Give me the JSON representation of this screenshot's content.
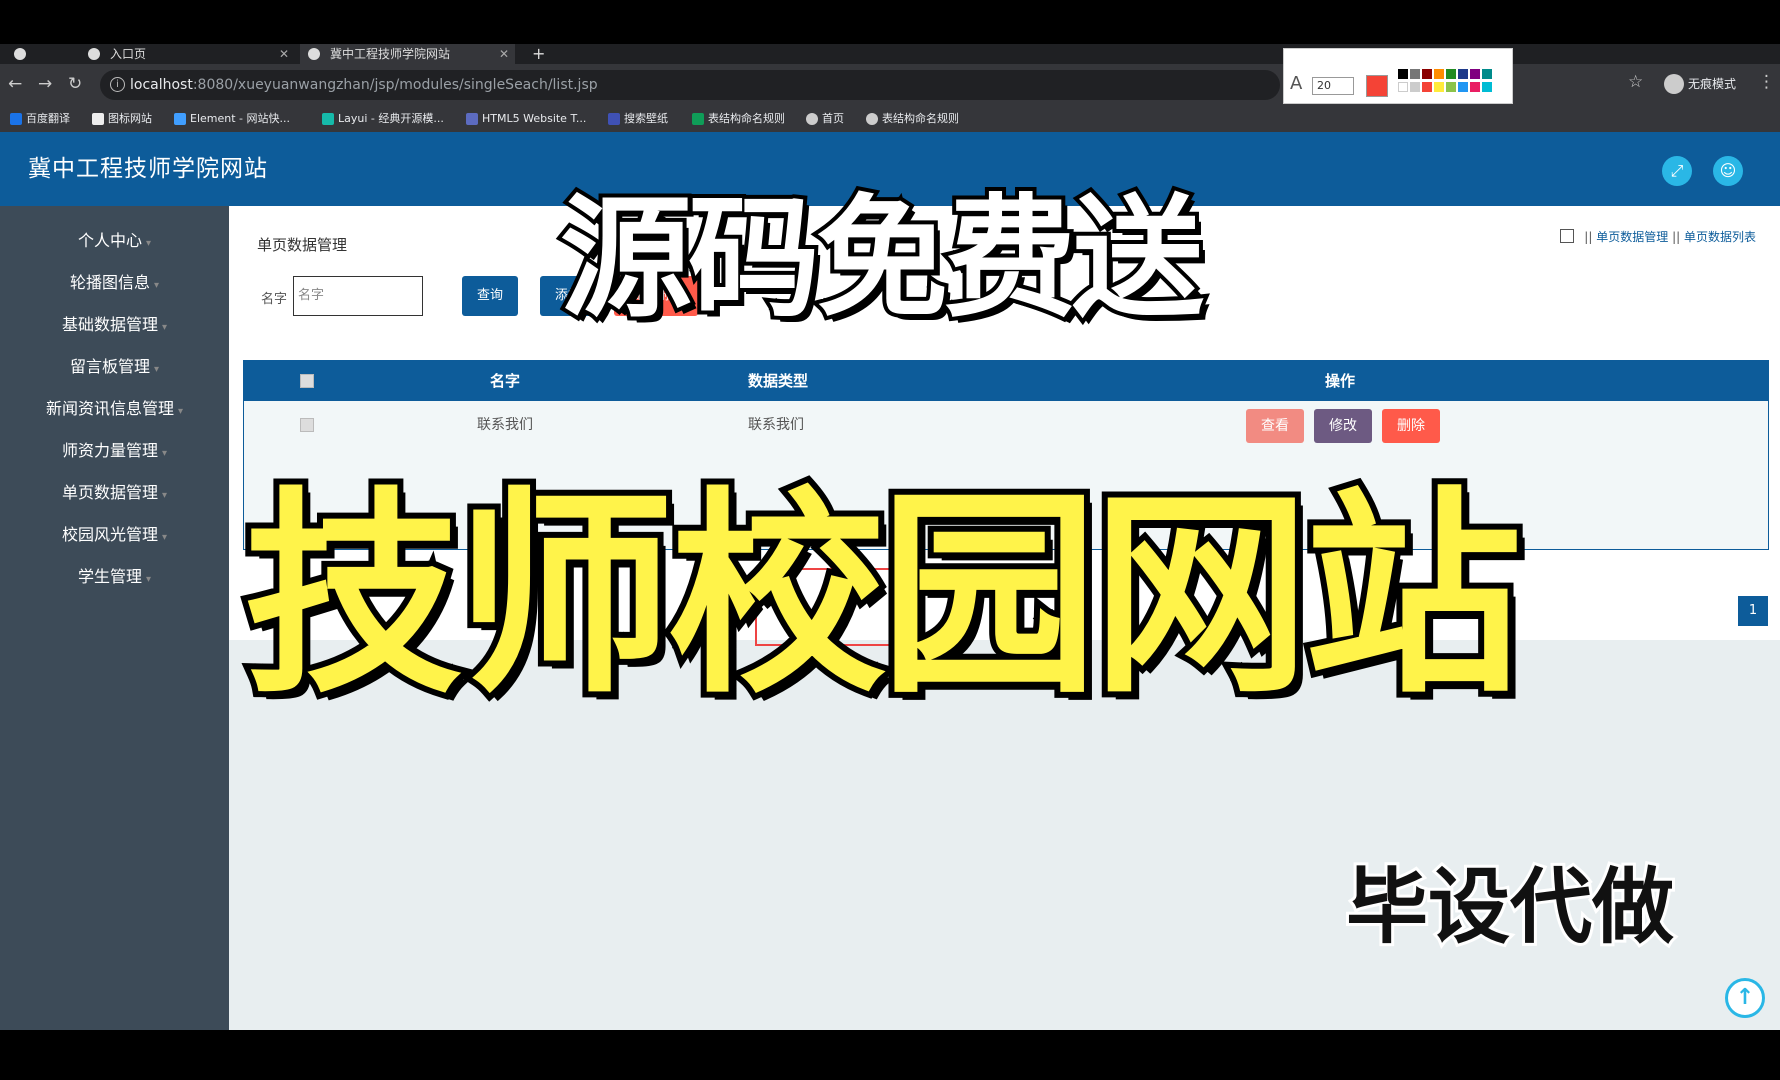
{
  "browser": {
    "tabs": [
      {
        "label": "入口页",
        "active": false
      },
      {
        "label": "冀中工程技师学院网站",
        "active": true
      }
    ],
    "url_host": "localhost",
    "url_rest": ":8080/xueyuanwangzhan/jsp/modules/singleSeach/list.jsp",
    "incognito_label": "无痕模式",
    "bookmarks": [
      {
        "label": "百度翻译",
        "color": "#1a73e8"
      },
      {
        "label": "图标网站",
        "color": "#222"
      },
      {
        "label": "Element - 网站快...",
        "color": "#409eff"
      },
      {
        "label": "Layui - 经典开源模...",
        "color": "#16baaa"
      },
      {
        "label": "HTML5 Website T...",
        "color": "#5c6bc0"
      },
      {
        "label": "搜索壁纸",
        "color": "#3f51b5"
      },
      {
        "label": "表结构命名规则",
        "color": "#0f9d58"
      },
      {
        "label": "首页",
        "color": "#ccc"
      },
      {
        "label": "表结构命名规则",
        "color": "#ccc"
      }
    ],
    "draw_tool": {
      "font_size": "20",
      "current_color": "#f44336"
    }
  },
  "app": {
    "site_title": "冀中工程技师学院网站",
    "sidebar": [
      "个人中心",
      "轮播图信息",
      "基础数据管理",
      "留言板管理",
      "新闻资讯信息管理",
      "师资力量管理",
      "单页数据管理",
      "校园风光管理",
      "学生管理"
    ],
    "page_name": "单页数据管理",
    "breadcrumb": [
      "单页数据管理",
      "单页数据列表"
    ],
    "search": {
      "label": "名字",
      "placeholder": "名字"
    },
    "buttons": {
      "query": "查询",
      "add": "添加",
      "batch_delete": "批量删除"
    },
    "table": {
      "headers": [
        "名字",
        "数据类型",
        "操作"
      ],
      "rows": [
        {
          "name": "联系我们",
          "type": "联系我们"
        }
      ],
      "row_actions": {
        "view": "查看",
        "edit": "修改",
        "delete": "删除"
      }
    },
    "pagination": {
      "current": "1"
    }
  },
  "overlay": {
    "caption_top": "源码免费送",
    "caption_main": "技师校园网站",
    "caption_bottom": "毕设代做"
  }
}
